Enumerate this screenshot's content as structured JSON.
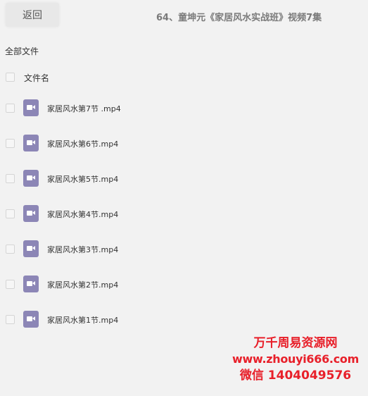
{
  "header": {
    "back_label": "返回",
    "title": "64、童坤元《家居风水实战班》视频7集"
  },
  "breadcrumb": "全部文件",
  "list": {
    "column_name": "文件名",
    "files": [
      {
        "name": "家居风水第7节 .mp4"
      },
      {
        "name": "家居风水第6节.mp4"
      },
      {
        "name": "家居风水第5节.mp4"
      },
      {
        "name": "家居风水第4节.mp4"
      },
      {
        "name": "家居风水第3节.mp4"
      },
      {
        "name": "家居风水第2节.mp4"
      },
      {
        "name": "家居风水第1节.mp4"
      }
    ],
    "file_icon": "video-file-icon",
    "file_icon_color": "#8c86b6"
  },
  "watermark": {
    "line1": "万千周易资源网",
    "line2": "www.zhouyi666.com",
    "line3": "微信 1404049576",
    "color": "#e8202a"
  }
}
